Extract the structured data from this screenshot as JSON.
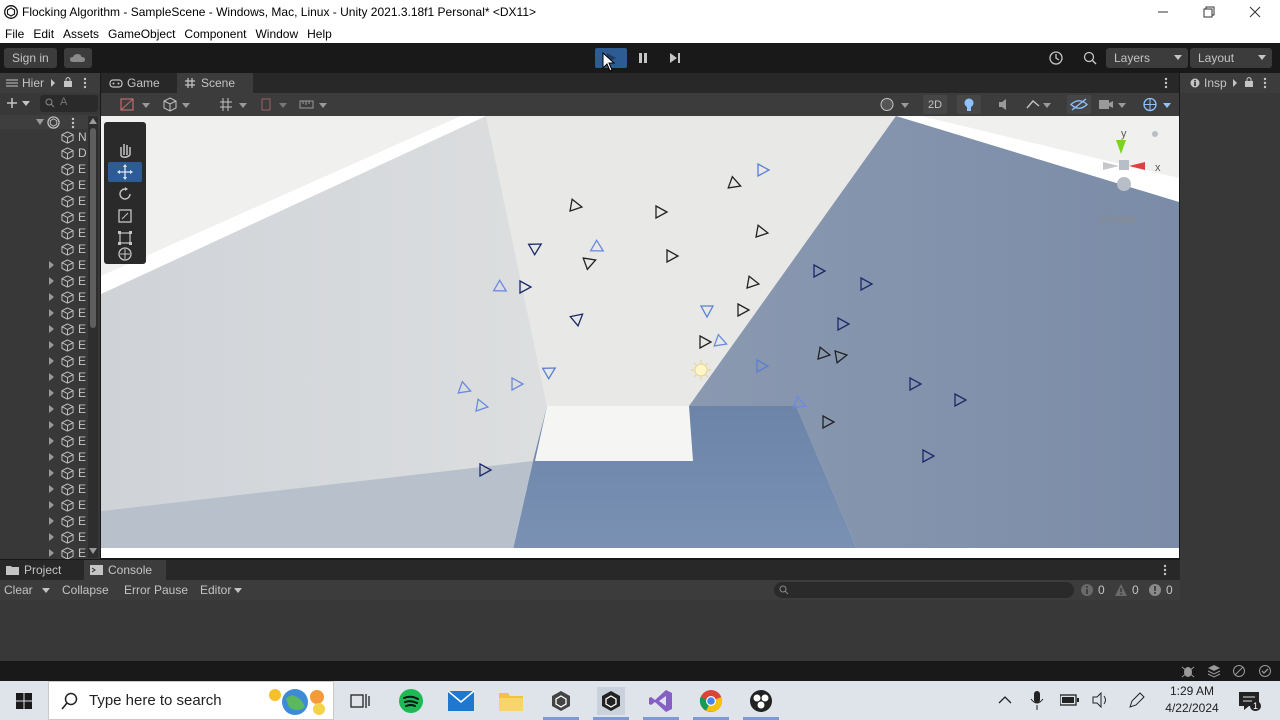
{
  "window": {
    "title": "Flocking Algorithm - SampleScene - Windows, Mac, Linux - Unity 2021.3.18f1 Personal* <DX11>"
  },
  "menu": [
    "File",
    "Edit",
    "Assets",
    "GameObject",
    "Component",
    "Window",
    "Help"
  ],
  "toolbar": {
    "sign_in": "Sign in",
    "layers": "Layers",
    "layout": "Layout"
  },
  "hierarchy": {
    "tab": "Hier",
    "search_placeholder": "A",
    "rows": [
      {
        "label": "N",
        "foldout": false
      },
      {
        "label": "D",
        "foldout": false
      },
      {
        "label": "E",
        "foldout": false
      },
      {
        "label": "E",
        "foldout": false
      },
      {
        "label": "E",
        "foldout": false
      },
      {
        "label": "E",
        "foldout": false
      },
      {
        "label": "E",
        "foldout": false
      },
      {
        "label": "E",
        "foldout": false
      },
      {
        "label": "E",
        "foldout": true
      },
      {
        "label": "E",
        "foldout": true
      },
      {
        "label": "E",
        "foldout": true
      },
      {
        "label": "E",
        "foldout": true
      },
      {
        "label": "E",
        "foldout": true
      },
      {
        "label": "E",
        "foldout": true
      },
      {
        "label": "E",
        "foldout": true
      },
      {
        "label": "E",
        "foldout": true
      },
      {
        "label": "E",
        "foldout": true
      },
      {
        "label": "E",
        "foldout": true
      },
      {
        "label": "E",
        "foldout": true
      },
      {
        "label": "E",
        "foldout": true
      },
      {
        "label": "E",
        "foldout": true
      },
      {
        "label": "E",
        "foldout": true
      },
      {
        "label": "E",
        "foldout": true
      },
      {
        "label": "E",
        "foldout": true
      },
      {
        "label": "E",
        "foldout": true
      },
      {
        "label": "E",
        "foldout": true
      },
      {
        "label": "E",
        "foldout": true
      },
      {
        "label": "E",
        "foldout": true
      }
    ]
  },
  "center_tabs": {
    "game": "Game",
    "scene": "Scene"
  },
  "scene_toolbar": {
    "mode_2d": "2D"
  },
  "gizmo": {
    "y_label": "y",
    "x_label": "x",
    "persp_label": "Persp"
  },
  "inspector": {
    "tab": "Insp"
  },
  "bottom": {
    "project_tab": "Project",
    "console_tab": "Console",
    "clear": "Clear",
    "collapse": "Collapse",
    "error_pause": "Error Pause",
    "editor": "Editor",
    "count_info": "0",
    "count_warning": "0",
    "count_error": "0"
  },
  "taskbar": {
    "search_placeholder": "Type here to search",
    "time": "1:29 AM",
    "date": "4/22/2024"
  },
  "colors": {
    "accent_blue": "#2d5b93",
    "panel": "#383838",
    "toolbar": "#191919",
    "tabstrip": "#282828",
    "scene_floor": "#6f86a8"
  }
}
